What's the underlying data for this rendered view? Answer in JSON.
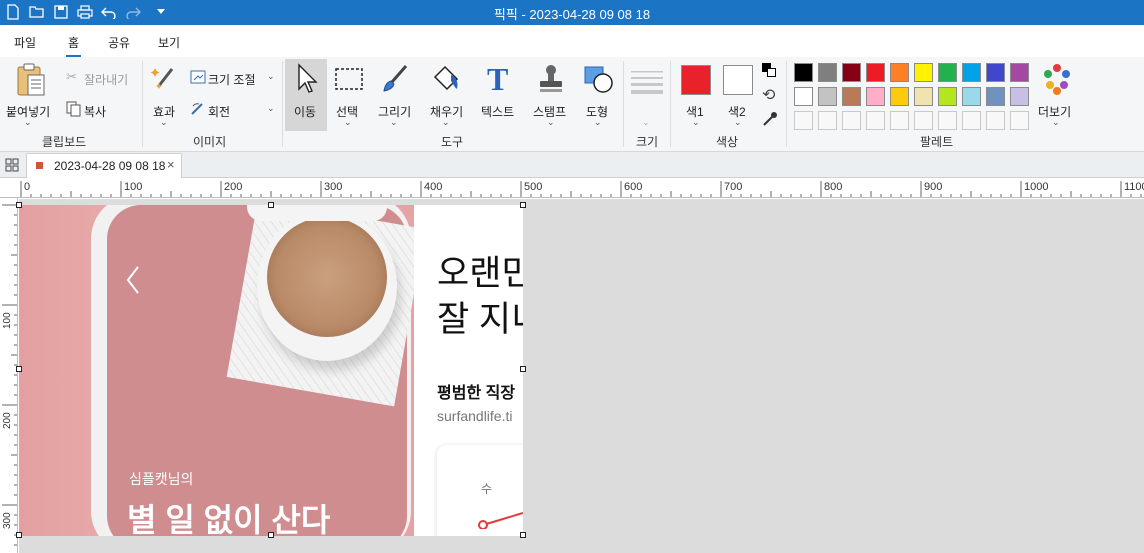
{
  "window": {
    "title": "픽픽 - 2023-04-28 09 08 18",
    "quick_access": [
      "new-file-icon",
      "open-folder-icon",
      "save-icon",
      "print-icon",
      "undo-icon",
      "redo-icon",
      "customize-dropdown-icon"
    ]
  },
  "menu": {
    "tabs": [
      "파일",
      "홈",
      "공유",
      "보기"
    ],
    "active": "홈"
  },
  "ribbon": {
    "clipboard": {
      "paste": "붙여넣기",
      "cut": "잘라내기",
      "copy": "복사",
      "group": "클립보드"
    },
    "image": {
      "effects": "효과",
      "resize": "크기 조절",
      "rotate": "회전",
      "group": "이미지"
    },
    "tools": {
      "move": "이동",
      "select": "선택",
      "draw": "그리기",
      "fill": "채우기",
      "text": "텍스트",
      "stamp": "스탬프",
      "shape": "도형",
      "group": "도구"
    },
    "size": {
      "group": "크기"
    },
    "color": {
      "color1": "색1",
      "color2": "색2",
      "group": "색상",
      "color1_value": "#e8212b",
      "color2_value": "#ffffff"
    },
    "palette": {
      "group": "팔레트",
      "more": "더보기",
      "row1": [
        "#000000",
        "#7f7f7f",
        "#880015",
        "#ed1c24",
        "#ff7f27",
        "#fff200",
        "#22b14c",
        "#00a2e8",
        "#3f48cc",
        "#a349a4"
      ],
      "row2": [
        "#ffffff",
        "#c3c3c3",
        "#b97a57",
        "#ffaec9",
        "#ffc90e",
        "#efe4b0",
        "#b5e61d",
        "#99d9ea",
        "#7092be",
        "#c8bfe7"
      ]
    }
  },
  "document": {
    "tab_name": "2023-04-28 09 08 18"
  },
  "ruler": {
    "top": [
      "0",
      "100",
      "200",
      "300",
      "400",
      "500",
      "600",
      "700",
      "800",
      "900",
      "1000",
      "1100"
    ],
    "left": [
      "100",
      "200",
      "300"
    ]
  },
  "canvas_image": {
    "phone_subtitle": "심플캣님의",
    "phone_title": "별 일 없이 산다",
    "heading_line1": "오랜민",
    "heading_line2": "잘 지니",
    "subheading": "평범한 직장",
    "url": "surfandlife.ti",
    "card_label": "수"
  }
}
